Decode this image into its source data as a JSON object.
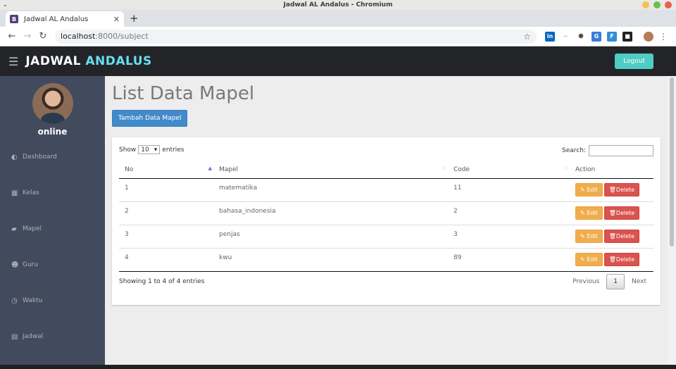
{
  "window": {
    "title": "Jadwal AL Andalus - Chromium"
  },
  "browser": {
    "tab_title": "Jadwal AL Andalus",
    "tab_favicon": "B",
    "url_host": "localhost",
    "url_path": ":8000/subject",
    "extensions": [
      "in",
      "~",
      "gear",
      "ts",
      "flag",
      "cube",
      "avatar"
    ]
  },
  "app": {
    "brand_part1": "JADWAL",
    "brand_part2": "ANDALUS",
    "logout_label": "Logout",
    "user_status": "online",
    "sidebar": [
      {
        "icon": "dashboard-icon",
        "glyph": "◐",
        "label": "Dashboard"
      },
      {
        "icon": "th-large-icon",
        "glyph": "▦",
        "label": "Kelas"
      },
      {
        "icon": "book-icon",
        "glyph": "▰",
        "label": "Mapel"
      },
      {
        "icon": "users-icon",
        "glyph": "☻",
        "label": "Guru"
      },
      {
        "icon": "clock-icon",
        "glyph": "◷",
        "label": "Waktu"
      },
      {
        "icon": "calendar-icon",
        "glyph": "▤",
        "label": "Jadwal"
      }
    ],
    "page_title": "List Data Mapel",
    "add_button": "Tambah Data Mapel",
    "show_label": "Show",
    "entries_count": "10",
    "entries_label": "entries",
    "search_label": "Search:",
    "columns": [
      "No",
      "Mapel",
      "Code",
      "Action"
    ],
    "rows": [
      {
        "no": "1",
        "mapel": "matematika",
        "code": "11"
      },
      {
        "no": "2",
        "mapel": "bahasa_indonesia",
        "code": "2"
      },
      {
        "no": "3",
        "mapel": "penjas",
        "code": "3"
      },
      {
        "no": "4",
        "mapel": "kwu",
        "code": "89"
      }
    ],
    "edit_label": "Edit",
    "delete_label": "Delete",
    "info_text": "Showing 1 to 4 of 4 entries",
    "pager": {
      "previous": "Previous",
      "current": "1",
      "next": "Next"
    }
  },
  "colors": {
    "brand_accent": "#68dff0",
    "logout": "#4ecdc4",
    "sidebar": "#424a5d",
    "primary": "#428bca",
    "warning": "#f0ad4e",
    "danger": "#d9534f"
  }
}
